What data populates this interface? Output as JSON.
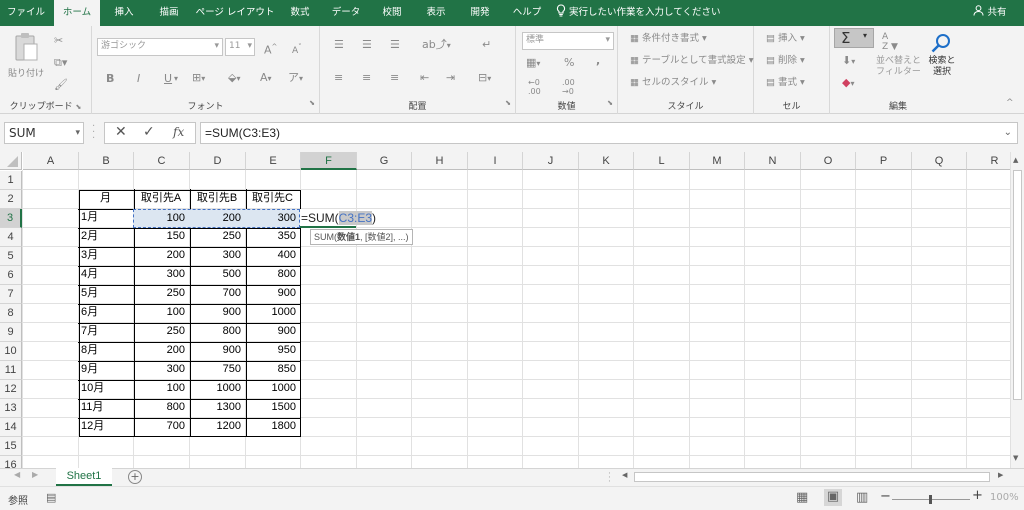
{
  "tabs": [
    {
      "label": "ファイル"
    },
    {
      "label": "ホーム"
    },
    {
      "label": "挿入"
    },
    {
      "label": "描画"
    },
    {
      "label": "ページ レイアウト"
    },
    {
      "label": "数式"
    },
    {
      "label": "データ"
    },
    {
      "label": "校閲"
    },
    {
      "label": "表示"
    },
    {
      "label": "開発"
    },
    {
      "label": "ヘルプ"
    }
  ],
  "tell_me": "実行したい作業を入力してください",
  "share": "共有",
  "ribbon": {
    "clipboard": {
      "label": "クリップボード",
      "paste": "貼り付け"
    },
    "font": {
      "label": "フォント",
      "name": "游ゴシック",
      "size": "11",
      "grow": "A",
      "shrink": "A",
      "bold": "B",
      "italic": "I",
      "underline": "U",
      "color": "A"
    },
    "alignment": {
      "label": "配置"
    },
    "number": {
      "label": "数値",
      "format": "標準",
      "percent": "%",
      "comma": ","
    },
    "styles": {
      "label": "スタイル",
      "conditional": "条件付き書式",
      "table": "テーブルとして書式設定",
      "cell": "セルのスタイル"
    },
    "cells": {
      "label": "セル",
      "insert": "挿入",
      "delete": "削除",
      "format": "書式"
    },
    "editing": {
      "label": "編集",
      "sigma": "Σ",
      "sort": "並べ替えと\nフィルター",
      "find": "検索と\n選択"
    }
  },
  "formula_bar": {
    "name_box": "SUM",
    "formula": "=SUM(C3:E3)",
    "fx": "fx"
  },
  "columns": [
    "A",
    "B",
    "C",
    "D",
    "E",
    "F",
    "G",
    "H",
    "I",
    "J",
    "K",
    "L",
    "M",
    "N",
    "O",
    "P",
    "Q",
    "R"
  ],
  "rows": [
    "1",
    "2",
    "3",
    "4",
    "5",
    "6",
    "7",
    "8",
    "9",
    "10",
    "11",
    "12",
    "13",
    "14",
    "15",
    "16"
  ],
  "table": {
    "headers": [
      "月",
      "取引先A",
      "取引先B",
      "取引先C"
    ],
    "rows": [
      [
        "1月",
        "100",
        "200",
        "300"
      ],
      [
        "2月",
        "150",
        "250",
        "350"
      ],
      [
        "3月",
        "200",
        "300",
        "400"
      ],
      [
        "4月",
        "300",
        "500",
        "800"
      ],
      [
        "5月",
        "250",
        "700",
        "900"
      ],
      [
        "6月",
        "100",
        "900",
        "1000"
      ],
      [
        "7月",
        "250",
        "800",
        "900"
      ],
      [
        "8月",
        "200",
        "900",
        "950"
      ],
      [
        "9月",
        "300",
        "750",
        "850"
      ],
      [
        "10月",
        "100",
        "1000",
        "1000"
      ],
      [
        "11月",
        "800",
        "1300",
        "1500"
      ],
      [
        "12月",
        "700",
        "1200",
        "1800"
      ]
    ]
  },
  "active_cell": {
    "before": "=SUM(",
    "ref": "C3:E3",
    "after": ")"
  },
  "tooltip": {
    "pre": "SUM(",
    "bold": "数値1",
    "post": ", [数値2], ...)"
  },
  "sheet_tab": "Sheet1",
  "status": {
    "mode": "参照",
    "zoom": "100%"
  },
  "colors": {
    "excel_green": "#217346",
    "ref_blue": "#4472c4",
    "selection_fill": "#dce6f1"
  }
}
